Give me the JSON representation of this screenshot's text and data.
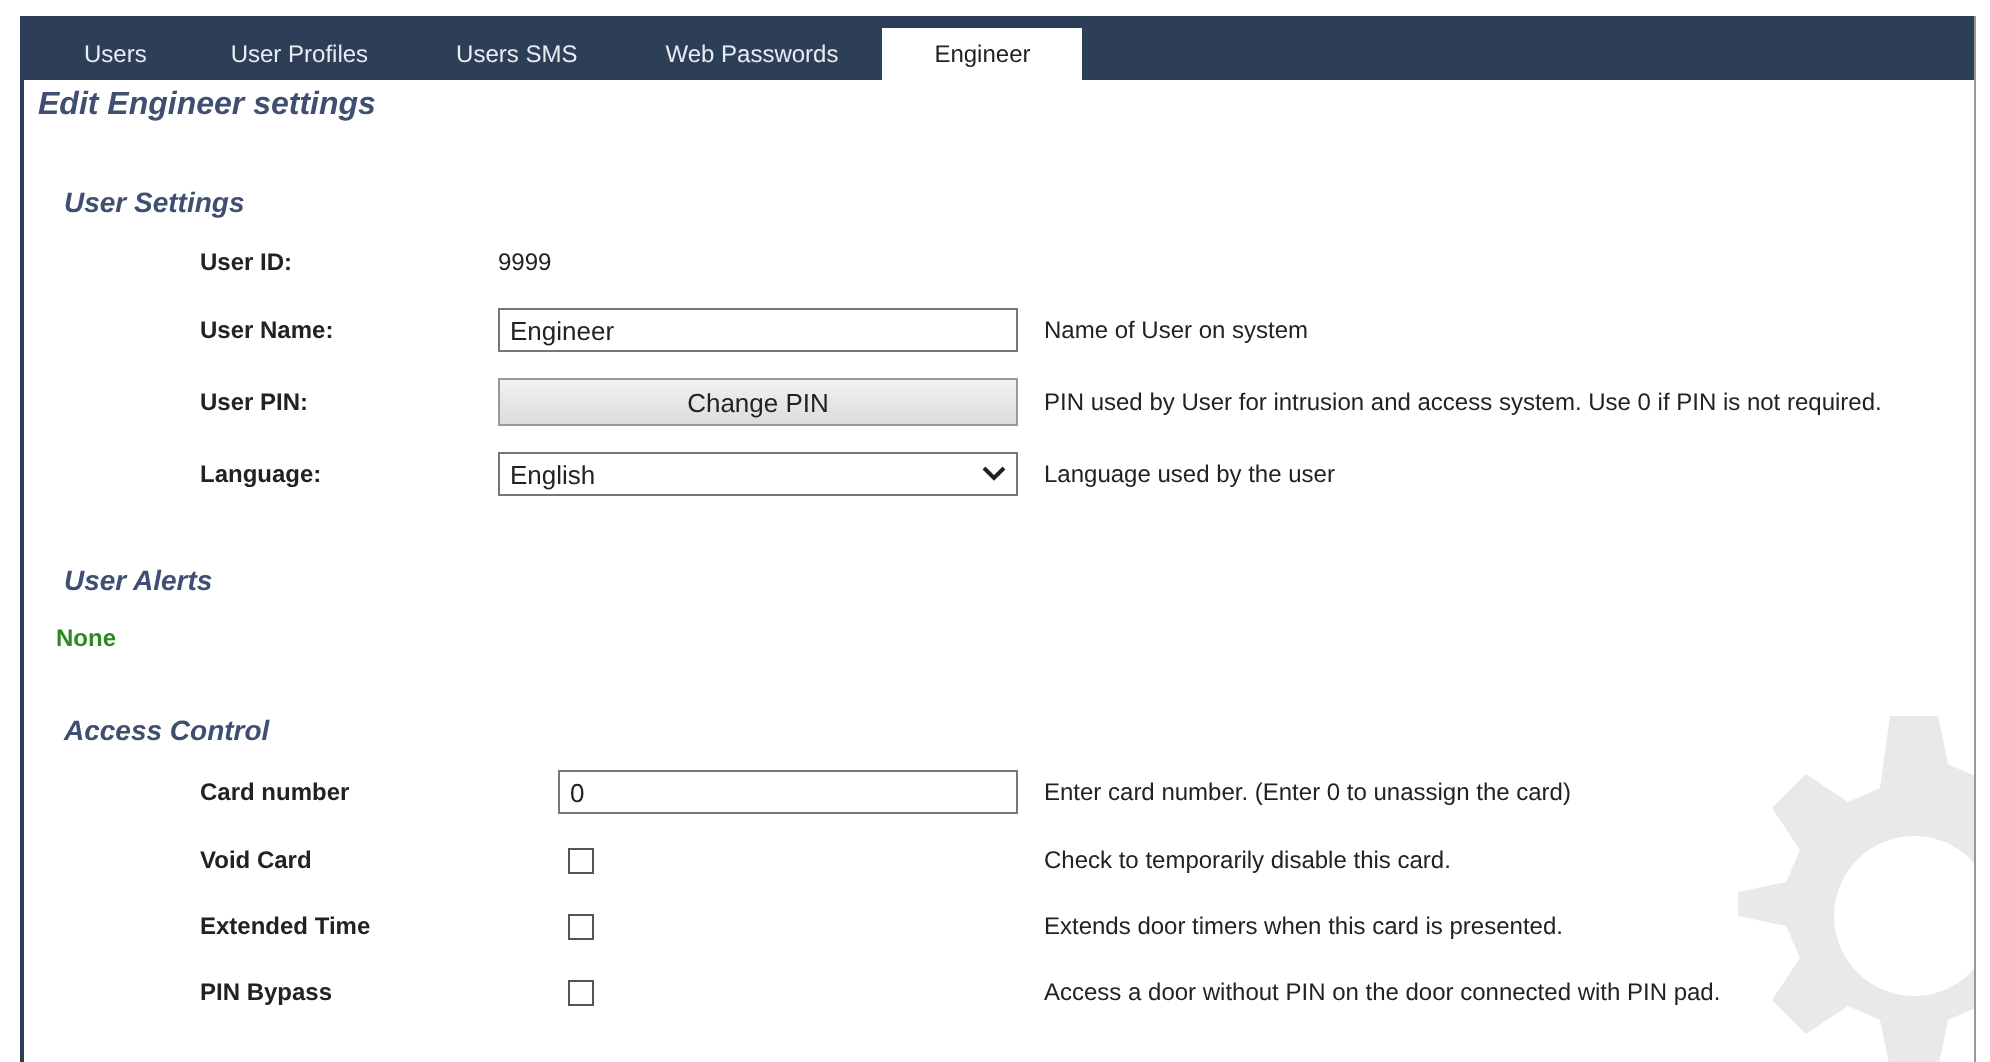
{
  "tabs": [
    {
      "label": "Users",
      "selected": false
    },
    {
      "label": "User Profiles",
      "selected": false
    },
    {
      "label": "Users SMS",
      "selected": false
    },
    {
      "label": "Web Passwords",
      "selected": false
    },
    {
      "label": "Engineer",
      "selected": true
    }
  ],
  "page_title": "Edit Engineer settings",
  "user_settings": {
    "title": "User Settings",
    "rows": [
      {
        "kind": "text",
        "label": "User ID:",
        "value": "9999"
      },
      {
        "kind": "input",
        "label": "User Name:",
        "value": "Engineer",
        "description": "Name of User on system"
      },
      {
        "kind": "button",
        "label": "User PIN:",
        "value": "Change PIN",
        "description": "PIN used by User for intrusion and access system. Use 0 if PIN is not required."
      },
      {
        "kind": "select",
        "label": "Language:",
        "value": "English",
        "description": "Language used by the user"
      }
    ]
  },
  "user_alerts": {
    "title": "User Alerts",
    "value": "None"
  },
  "access_control": {
    "title": "Access Control",
    "rows": [
      {
        "kind": "input",
        "label": "Card number",
        "value": "0",
        "description": "Enter card number. (Enter 0 to unassign the card)"
      },
      {
        "kind": "checkbox",
        "label": "Void Card",
        "checked": false,
        "description": "Check to temporarily disable this card."
      },
      {
        "kind": "checkbox",
        "label": "Extended Time",
        "checked": false,
        "description": "Extends door timers when this card is presented."
      },
      {
        "kind": "checkbox",
        "label": "PIN Bypass",
        "checked": false,
        "description": "Access a door without PIN on the door connected with PIN pad."
      }
    ]
  }
}
